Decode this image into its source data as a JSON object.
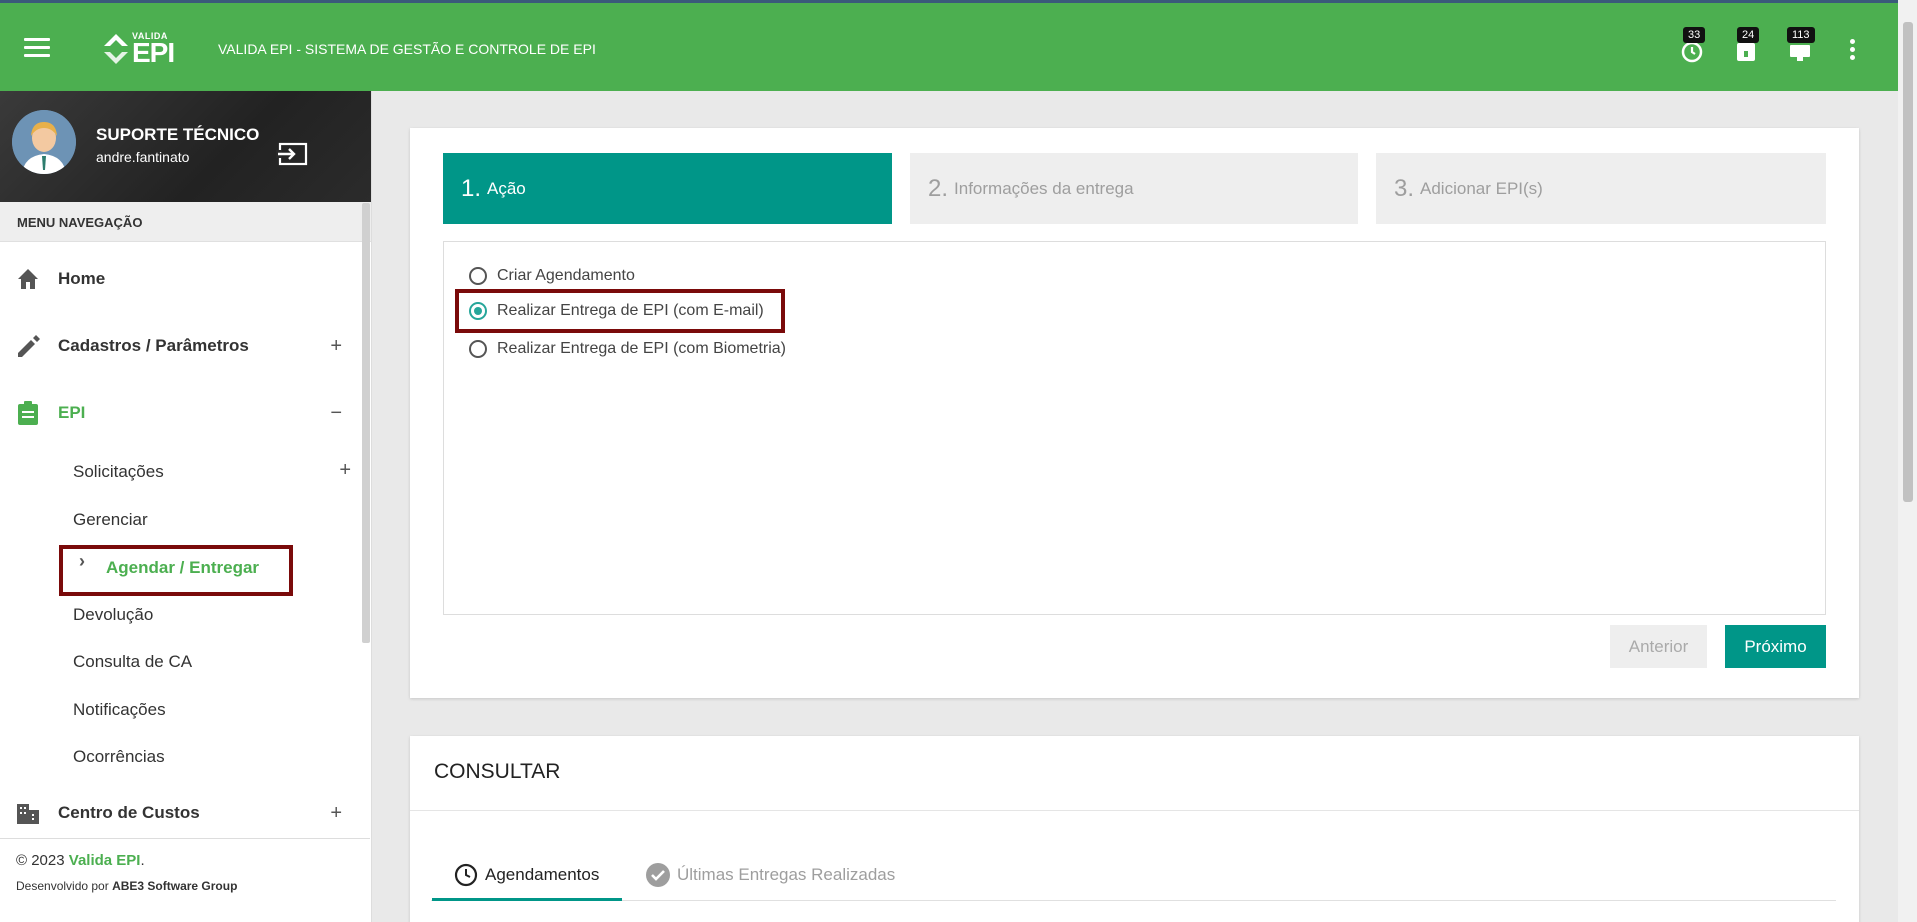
{
  "topbar": {
    "logo_small": "VALIDA",
    "logo_big": "EPI",
    "title": "VALIDA EPI - SISTEMA DE GESTÃO E CONTROLE DE EPI",
    "badges": {
      "clock": "33",
      "clipboard": "24",
      "alerts": "113"
    }
  },
  "user": {
    "name": "SUPORTE TÉCNICO",
    "login": "andre.fantinato"
  },
  "menu": {
    "header": "MENU NAVEGAÇÃO",
    "home": "Home",
    "cadastros": "Cadastros / Parâmetros",
    "epi": "EPI",
    "sub": {
      "solicitacoes": "Solicitações",
      "gerenciar": "Gerenciar",
      "agendar": "Agendar / Entregar",
      "devolucao": "Devolução",
      "consulta_ca": "Consulta de CA",
      "notificacoes": "Notificações",
      "ocorrencias": "Ocorrências"
    },
    "centro_custos": "Centro de Custos",
    "plus": "+",
    "minus": "−"
  },
  "footer": {
    "copyright": "© 2023",
    "brand": "Valida EPI",
    "dot": ".",
    "dev_prefix": "Desenvolvido por",
    "dev_company": "ABE3 Software Group"
  },
  "wizard": {
    "steps": [
      {
        "num": "1.",
        "label": "Ação"
      },
      {
        "num": "2.",
        "label": "Informações da entrega"
      },
      {
        "num": "3.",
        "label": "Adicionar EPI(s)"
      }
    ],
    "options": [
      "Criar Agendamento",
      "Realizar Entrega de EPI (com E-mail)",
      "Realizar Entrega de EPI (com Biometria)"
    ],
    "selected_index": 1,
    "prev_label": "Anterior",
    "next_label": "Próximo"
  },
  "consultar": {
    "title": "CONSULTAR",
    "tabs": [
      "Agendamentos",
      "Últimas Entregas Realizadas"
    ]
  },
  "colors": {
    "topbar": "#4caf50",
    "teal": "#009688",
    "highlight": "#7a0a0a"
  }
}
